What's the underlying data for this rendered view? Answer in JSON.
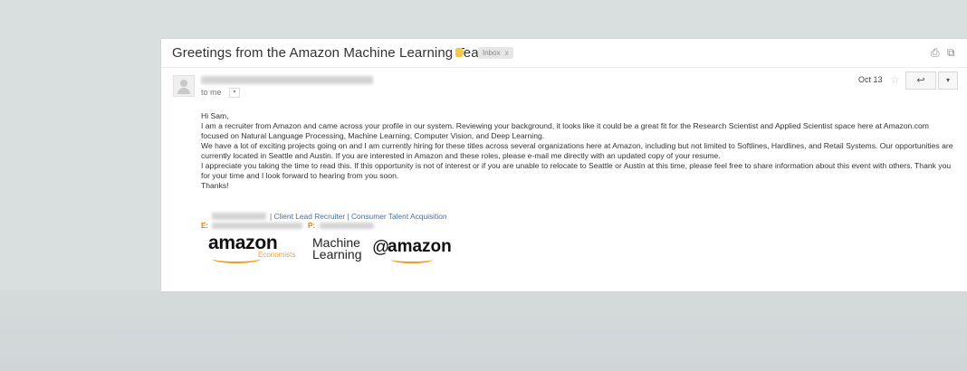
{
  "email": {
    "subject": "Greetings from the Amazon Machine Learning Team!",
    "label_chip": "Inbox",
    "label_chip_close": "x",
    "to_line": "to me",
    "to_caret": "▾",
    "date": "Oct 13",
    "star_glyph": "☆",
    "reply_glyph": "↩",
    "more_glyph": "▾",
    "print_glyph": "⎙",
    "newwindow_glyph": "⧉",
    "importance_color": "#f4c94e",
    "body": [
      "Hi Sam,",
      "I am a recruiter from Amazon and came across your profile in our system. Reviewing your background, it looks like it could be a great fit for the Research Scientist and Applied Scientist space here at Amazon.com focused on Natural Language Processing, Machine Learning, Computer Vision, and Deep Learning.",
      "We have a lot of exciting projects going on and I am currently hiring for these titles across several organizations here at Amazon, including but not limited to Softlines, Hardlines, and Retail Systems. Our opportunities are currently located in Seattle and Austin. If you are interested in Amazon and these roles, please e-mail me directly with an updated copy of your resume.",
      "I appreciate you taking the time to read this. If this opportunity is not of interest or if you are unable to relocate to Seattle or Austin at this time, please feel free to share information about this event with others. Thank you for your time and I look forward to hearing from you soon.",
      "Thanks!"
    ],
    "signature": {
      "title": "| Client Lead Recruiter | Consumer Talent Acquisition",
      "email_prefix": "E:",
      "phone_prefix": "P:"
    },
    "logos": {
      "amazon": "amazon",
      "economists": "Economists",
      "machine": "Machine",
      "learning": "Learning",
      "at": "@",
      "amazon2": "amazon"
    }
  }
}
